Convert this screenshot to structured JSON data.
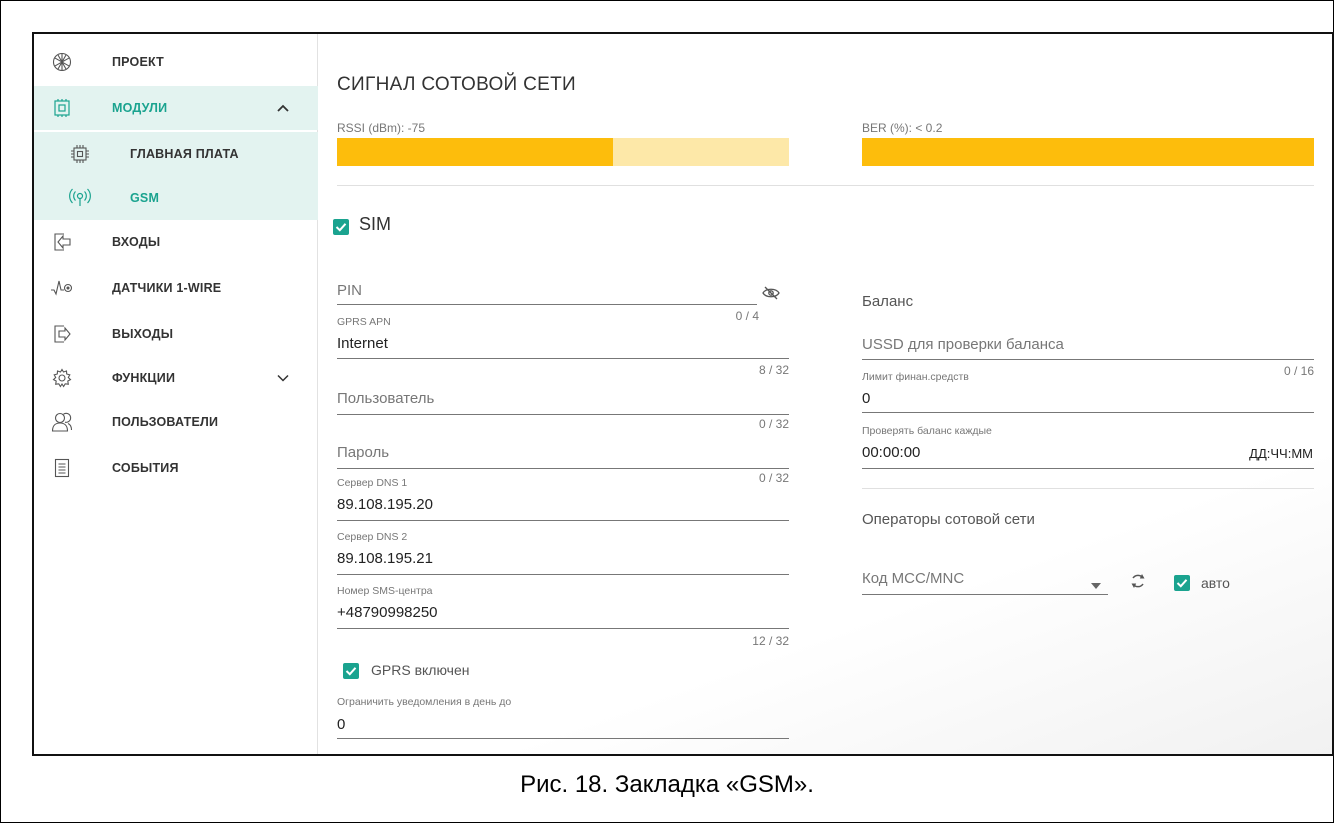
{
  "sidebar": {
    "items": [
      {
        "label": "ПРОЕКТ",
        "icon": "project-icon"
      },
      {
        "label": "МОДУЛИ",
        "icon": "modules-icon",
        "expanded": true
      },
      {
        "label": "ГЛАВНАЯ ПЛАТА",
        "icon": "mainboard-icon"
      },
      {
        "label": "GSM",
        "icon": "gsm-antenna-icon",
        "active": true
      },
      {
        "label": "ВХОДЫ",
        "icon": "inputs-icon"
      },
      {
        "label": "ДАТЧИКИ 1-WIRE",
        "icon": "sensor-1wire-icon"
      },
      {
        "label": "ВЫХОДЫ",
        "icon": "outputs-icon"
      },
      {
        "label": "ФУНКЦИИ",
        "icon": "functions-gear-icon",
        "expanded": false
      },
      {
        "label": "ПОЛЬЗОВАТЕЛИ",
        "icon": "users-icon"
      },
      {
        "label": "СОБЫТИЯ",
        "icon": "events-document-icon"
      }
    ]
  },
  "signal": {
    "title": "СИГНАЛ СОТОВОЙ СЕТИ",
    "rssi_label": "RSSI (dBm): -75",
    "rssi_level": 0.61,
    "ber_label": "BER (%): < 0.2",
    "ber_level": 1.0,
    "bar_color": "#fdbd0c",
    "bar_bg_color": "#fde8a8"
  },
  "sim": {
    "label": "SIM",
    "checked": true,
    "accent_color": "#1aa38f"
  },
  "left_fields": {
    "pin": {
      "placeholder": "PIN",
      "counter": "0 / 4"
    },
    "apn": {
      "label": "GPRS APN",
      "value": "Internet",
      "counter": "8 / 32"
    },
    "user": {
      "placeholder": "Пользователь",
      "counter": "0 / 32"
    },
    "password": {
      "placeholder": "Пароль",
      "counter": "0 / 32"
    },
    "dns1": {
      "label": "Сервер DNS 1",
      "value": "89.108.195.20"
    },
    "dns2": {
      "label": "Сервер DNS 2",
      "value": "89.108.195.21"
    },
    "sms": {
      "label": "Номер SMS-центра",
      "value": "+48790998250",
      "counter": "12 / 32"
    },
    "gprs": {
      "label": "GPRS включен",
      "checked": true
    },
    "limit": {
      "label": "Ограничить уведомления в день до",
      "value": "0"
    }
  },
  "right_fields": {
    "balance_title": "Баланс",
    "ussd": {
      "placeholder": "USSD для проверки баланса",
      "counter": "0 / 16"
    },
    "funds_limit": {
      "label": "Лимит финан.средств",
      "value": "0"
    },
    "check_every": {
      "label": "Проверять баланс каждые",
      "value": "00:00:00",
      "suffix": "ДД:ЧЧ:ММ"
    },
    "operators_title": "Операторы сотовой сети",
    "mcc": {
      "placeholder": "Код MCC/MNC"
    },
    "auto": {
      "label": "авто",
      "checked": true
    }
  },
  "caption": "Рис. 18. Закладка «GSM»."
}
